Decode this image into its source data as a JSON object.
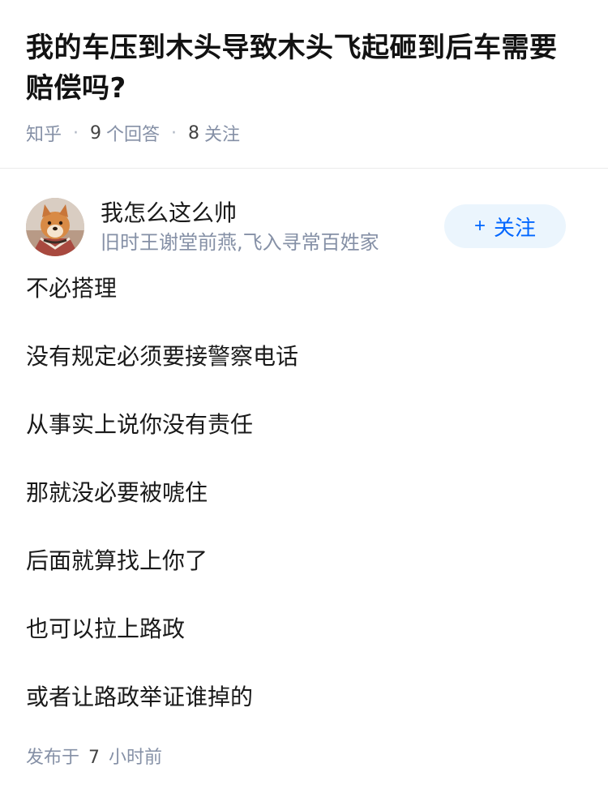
{
  "question": {
    "title": "我的车压到木头导致木头飞起砸到后车需要赔偿吗?",
    "source": "知乎",
    "answer_count": "9",
    "answer_label": "个回答",
    "follow_count": "8",
    "follow_label": "关注"
  },
  "answer": {
    "author": {
      "name": "我怎么这么帅",
      "bio": "旧时王谢堂前燕,飞入寻常百姓家",
      "avatar_icon": "dog-avatar"
    },
    "follow_button": {
      "plus": "+",
      "label": "关注"
    },
    "paragraphs": [
      "不必搭理",
      "没有规定必须要接警察电话",
      "从事实上说你没有责任",
      "那就没必要被唬住",
      "后面就算找上你了",
      "也可以拉上路政",
      "或者让路政举证谁掉的"
    ],
    "published": {
      "prefix": "发布于",
      "value": "7",
      "suffix": "小时前"
    }
  },
  "colors": {
    "accent": "#0066ff",
    "meta": "#8590a6",
    "button_bg": "#ebf5fd"
  }
}
